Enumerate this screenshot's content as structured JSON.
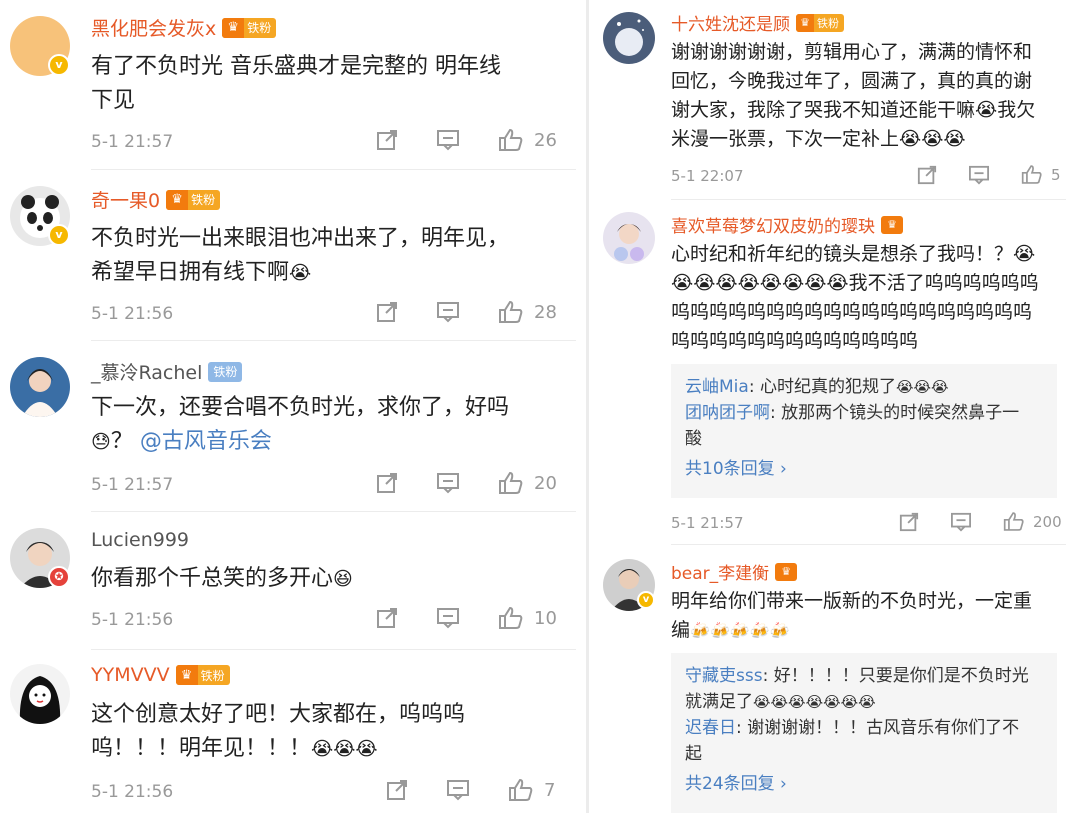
{
  "left": [
    {
      "username": "黑化肥会发灰x",
      "badge": "铁粉",
      "text_lines": [
        "有了不负时光 音乐盛典才是完整的 明年线",
        "下见"
      ],
      "time": "5-1 21:57",
      "likes": "26"
    },
    {
      "username": "奇一果0",
      "badge": "铁粉",
      "text_lines": [
        "不负时光一出来眼泪也冲出来了，明年见，",
        "希望早日拥有线下啊"
      ],
      "time": "5-1 21:56",
      "likes": "28"
    },
    {
      "username": "_慕泠Rachel",
      "badge": "铁粉",
      "text_line1": "下一次，还要合唱不负时光，求你了，好吗",
      "text_line2_prefix": "？",
      "mention": "@古风音乐会",
      "time": "5-1 21:57",
      "likes": "20"
    },
    {
      "username": "Lucien999",
      "text_lines": [
        "你看那个千总笑的多开心"
      ],
      "time": "5-1 21:56",
      "likes": "10"
    },
    {
      "username": "YYMVVV",
      "badge": "铁粉",
      "text_lines": [
        "这个创意太好了吧！大家都在，呜呜呜",
        "呜！！！明年见！！！"
      ],
      "time": "5-1 21:56",
      "likes": "7"
    }
  ],
  "right": [
    {
      "username": "十六姓沈还是顾",
      "badge": "铁粉",
      "text_lines": [
        "谢谢谢谢谢谢，剪辑用心了，满满的情怀和",
        "回忆，今晚我过年了，圆满了，真的真的谢",
        "谢大家，我除了哭我不知道还能干嘛",
        "米漫一张票，下次一定补上"
      ],
      "line3_suffix": "我欠",
      "time": "5-1 22:07",
      "likes": "5"
    },
    {
      "username": "喜欢草莓梦幻双皮奶的璎玦",
      "text_lines": [
        "心时纪和祈年纪的镜头是想杀了我吗！？",
        "我不活了呜呜呜呜呜呜",
        "呜呜呜呜呜呜呜呜呜呜呜呜呜呜呜呜呜呜呜",
        "呜呜呜呜呜呜呜呜呜呜呜呜呜"
      ],
      "replies": [
        {
          "name": "云岫Mia",
          "text": ": 心时纪真的犯规了"
        },
        {
          "name": "团呐团子啊",
          "text": ": 放那两个镜头的时候突然鼻子一",
          "text2": "酸"
        }
      ],
      "more": "共10条回复 ›",
      "time": "5-1 21:57",
      "likes": "200"
    },
    {
      "username": "bear_李建衡",
      "text_lines": [
        "明年给你们带来一版新的不负时光，一定重",
        "编"
      ],
      "replies": [
        {
          "name": "守藏吏sss",
          "text": ": 好！！！！只要是你们是不负时光",
          "text2": "就满足了"
        },
        {
          "name": "迟春日",
          "text": ": 谢谢谢谢！！！古风音乐有你们了不",
          "text2": "起"
        }
      ],
      "more": "共24条回复 ›"
    }
  ],
  "icons": [
    "share-icon",
    "comment-icon",
    "like-icon",
    "crown-icon",
    "crying-emoji",
    "verified-icon"
  ],
  "colors": {
    "username": "#e65a28",
    "link": "#4a7fc1",
    "meta": "#999999",
    "vip": "#f6b800"
  }
}
